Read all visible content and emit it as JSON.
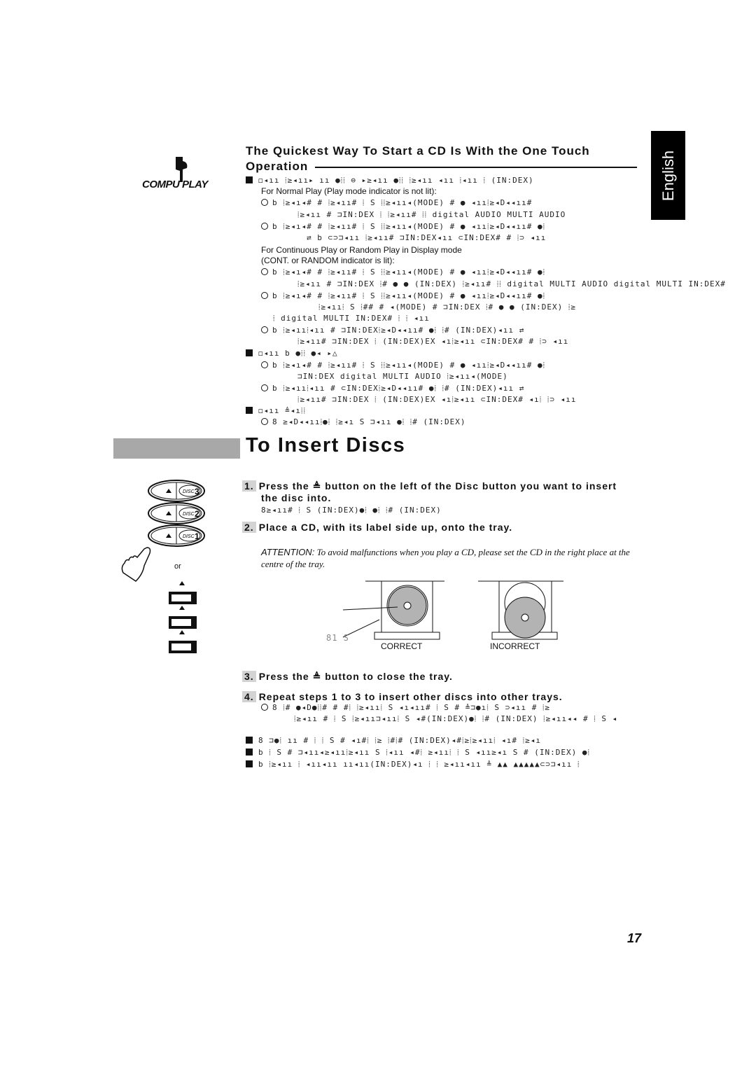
{
  "language_tab": "English",
  "logo": {
    "text": "COMPU PLAY",
    "icon": "pointing-hand-icon"
  },
  "section1": {
    "title_line1": "The Quickest Way To Start a CD Is With the One Touch",
    "title_line2": "Operation",
    "subhead1": "◻◂ıı ⦙≥◂ıı▸ ıı ●⦙⦙  ⊖ ▸≥◂ıı ●⦙⦙   ⦙≥◂ıı ◂ıı ⦙◂ıı  ⦙ (IN:DEX)",
    "normal_play_note": "For Normal Play (Play mode indicator is not lit):",
    "normal_items": [
      "b ⦙≥◂ı◂#   # ⦙≥◂ıı#  ⦙ S  ⦙⦙≥◂ıı◂(MODE) #  ●  ◂ıı⦙≥◂D◂◂ıı#",
      "⦙≥◂ıı  # ⊐IN:DEX ⦙  ⦙≥◂ıı# ⦙⦙  digital AUDIO MULTI AUDIO",
      "b ⦙≥◂ı◂#   # ⦙≥◂ıı#  ⦙ S  ⦙⦙≥◂ıı◂(MODE) #  ●  ◂ıı⦙≥◂D◂◂ıı# ●⦙",
      "⇄ b ⊂⊃⊐◂ıı   ⦙≥◂ıı# ⊐IN:DEX◂ıı ⊂IN:DEX# # ⦙⊃  ◂ıı"
    ],
    "continuous_note_1": "For Continuous Play or Random Play in Display mode",
    "continuous_note_2": "(CONT. or RANDOM indicator is lit):",
    "continuous_items": [
      "b ⦙≥◂ı◂#   # ⦙≥◂ıı#  ⦙ S  ⦙⦙≥◂ıı◂(MODE) #  ●  ◂ıı⦙≥◂D◂◂ıı# ●⦙",
      "⦙≥◂ıı  # ⊐IN:DEX  ⦙# ● ● (IN:DEX) ⦙≥◂ıı# ⦙⦙  digital MULTI AUDIO digital MULTI IN:DEX#",
      "b ⦙≥◂ı◂#   # ⦙≥◂ıı#  ⦙ S  ⦙⦙≥◂ıı◂(MODE) #  ●  ◂ıı⦙≥◂D◂◂ıı# ●⦙",
      "⦙≥◂ıı⦙ S  ⦙## # ◂(MODE) # ⊐IN:DEX ⦙# ● ● (IN:DEX) ⦙≥",
      "⦙ digital MULTI IN:DEX# ⦙  ⦙ ◂ıı",
      "b ⦙≥◂ıı⦙◂ıı  #  ⊐IN:DEX⦙≥◂D◂◂ıı# ●⦙ ⦙# (IN:DEX)◂ıı  ⇄",
      "⦙≥◂ıı# ⊐IN:DEX ⦙ (IN:DEX)EX ◂ı⦙≥◂ıı ⊂IN:DEX# # ⦙⊃  ◂ıı"
    ],
    "subhead2": "◻◂ıı  b  ●⦙⦙ ●◂ ▸△",
    "sub2_items": [
      "b ⦙≥◂ı◂#   # ⦙≥◂ıı#  ⦙ S  ⦙⦙≥◂ıı◂(MODE) #  ●  ◂ıı⦙≥◂D◂◂ıı# ●⦙",
      "⊐IN:DEX digital MULTI AUDIO  ⦙≥◂ıı◂(MODE)",
      "b ⦙≥◂ıı⦙◂ıı  #  ⊂IN:DEX⦙≥◂D◂◂ıı# ●⦙ ⦙# (IN:DEX)◂ıı  ⇄",
      "⦙≥◂ıı# ⊐IN:DEX ⦙ (IN:DEX)EX ◂ı⦙≥◂ıı ⊂IN:DEX# ◂ı⦙ ⦙⊃  ◂ıı"
    ],
    "subhead3": "◻◂ıı ≜◂ı⦙⦙",
    "sub3_items": [
      "8 ≥◂D◂◂ıı⦙●⦙   ⦙≥◂ı S ⊐◂ıı ●⦙ ⦙# (IN:DEX)"
    ]
  },
  "section2": {
    "title": "To Insert Discs",
    "steps": [
      {
        "num": "1.",
        "text": "Press the ≜ button on the left of the Disc button you want to insert",
        "text2": "the disc into."
      },
      {
        "num": "2.",
        "text": "Place a CD, with its label side up, onto the tray."
      },
      {
        "num": "3.",
        "text": "Press the ≜ button to close the tray."
      },
      {
        "num": "4.",
        "text": "Repeat steps 1 to 3 to insert other discs into other trays."
      }
    ],
    "step1_sub": "8≥◂ıı#  ⦙ S  (IN:DEX)●⦙ ●⦙   ⦙# (IN:DEX)",
    "attention_label": "ATTENTION:",
    "attention_text": " To avoid malfunctions when you play a CD, please set the CD in the right place at the centre of the tray.",
    "diagram": {
      "left_label": "81 S",
      "correct": "CORRECT",
      "incorrect": "INCORRECT"
    },
    "step4_items": [
      "8   ⦙# ●◂D●⦙⦙#  #  #⦙  ⦙≥◂ıı⦙ S  ◂ı◂ıı#  ⦙ S # ≜⊐●ı⦙ S ⊃◂ıı #  ⦙≥",
      "⦙≥◂ıı #  ⦙ S ⦙≥◂ıı⊐◂ıı⦙ S ◂#(IN:DEX)●⦙  ⦙# (IN:DEX) ⦙≥◂ıı◂◂ # ⦙ S ◂"
    ],
    "notes": [
      "8 ⊐●⦙  ıı    # ⦙  ⦙ S # ◂ı#⦙  ⦙≥ ⦙#⦙# (IN:DEX)◂#⦙≥⦙≥◂ıı⦙  ◂ı# ⦙≥◂ı",
      "b  ⦙ S #  ⊐◂ıı◂≥◂ıı⦙≥◂ıı S ⦙◂ıı ◂#⦙ ≥◂ıı⦙ ⦙  S  ◂ıı≥◂ı S # (IN:DEX) ●⦙",
      "b ⦙≥◂ıı    ⦙ ◂ıı◂ıı  ıı◂ıı(IN:DEX)◂ı  ⦙ ⦙ ≥◂ıı◂ıı ≜ ▲▲ ▲▲▲▲▲⊂⊃⊐◂ıı  ⦙"
    ],
    "or_label": "or",
    "disc_buttons": [
      "DISC 3",
      "DISC 2",
      "DISC 1"
    ]
  },
  "page_number": "17"
}
